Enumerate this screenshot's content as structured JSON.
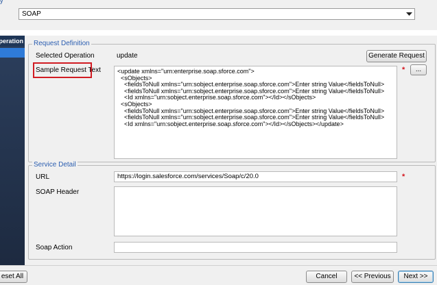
{
  "top": {
    "label_fragment": "y",
    "protocol_value": "SOAP"
  },
  "sidebar": {
    "header": "peration"
  },
  "request_definition": {
    "legend": "Request Definition",
    "selected_operation_label": "Selected Operation",
    "selected_operation_value": "update",
    "generate_button": "Generate Request",
    "sample_request_label": "Sample Request Text",
    "ellipsis_button": "...",
    "sample_request_text": "<update xmlns=\"urn:enterprise.soap.sforce.com\">\n  <sObjects>\n    <fieldsToNull xmlns=\"urn:sobject.enterprise.soap.sforce.com\">Enter string Value</fieldsToNull>\n    <fieldsToNull xmlns=\"urn:sobject.enterprise.soap.sforce.com\">Enter string Value</fieldsToNull>\n    <Id xmlns=\"urn:sobject.enterprise.soap.sforce.com\"></Id></sObjects>\n  <sObjects>\n    <fieldsToNull xmlns=\"urn:sobject.enterprise.soap.sforce.com\">Enter string Value</fieldsToNull>\n    <fieldsToNull xmlns=\"urn:sobject.enterprise.soap.sforce.com\">Enter string Value</fieldsToNull>\n    <Id xmlns=\"urn:sobject.enterprise.soap.sforce.com\"></Id></sObjects></update>",
    "required_mark": "*"
  },
  "service_detail": {
    "legend": "Service Detail",
    "url_label": "URL",
    "url_value": "https://login.salesforce.com/services/Soap/c/20.0",
    "soap_header_label": "SOAP Header",
    "soap_header_value": "",
    "soap_action_label": "Soap Action",
    "soap_action_value": "",
    "required_mark": "*"
  },
  "footer": {
    "reset_button": "eset All",
    "cancel_button": "Cancel",
    "previous_button": "<< Previous",
    "next_button": "Next >>"
  },
  "colors": {
    "accent": "#2a5db0",
    "required": "#d4141c",
    "highlight_border": "#d11b22",
    "sidebar_active": "#2f7bd8"
  }
}
